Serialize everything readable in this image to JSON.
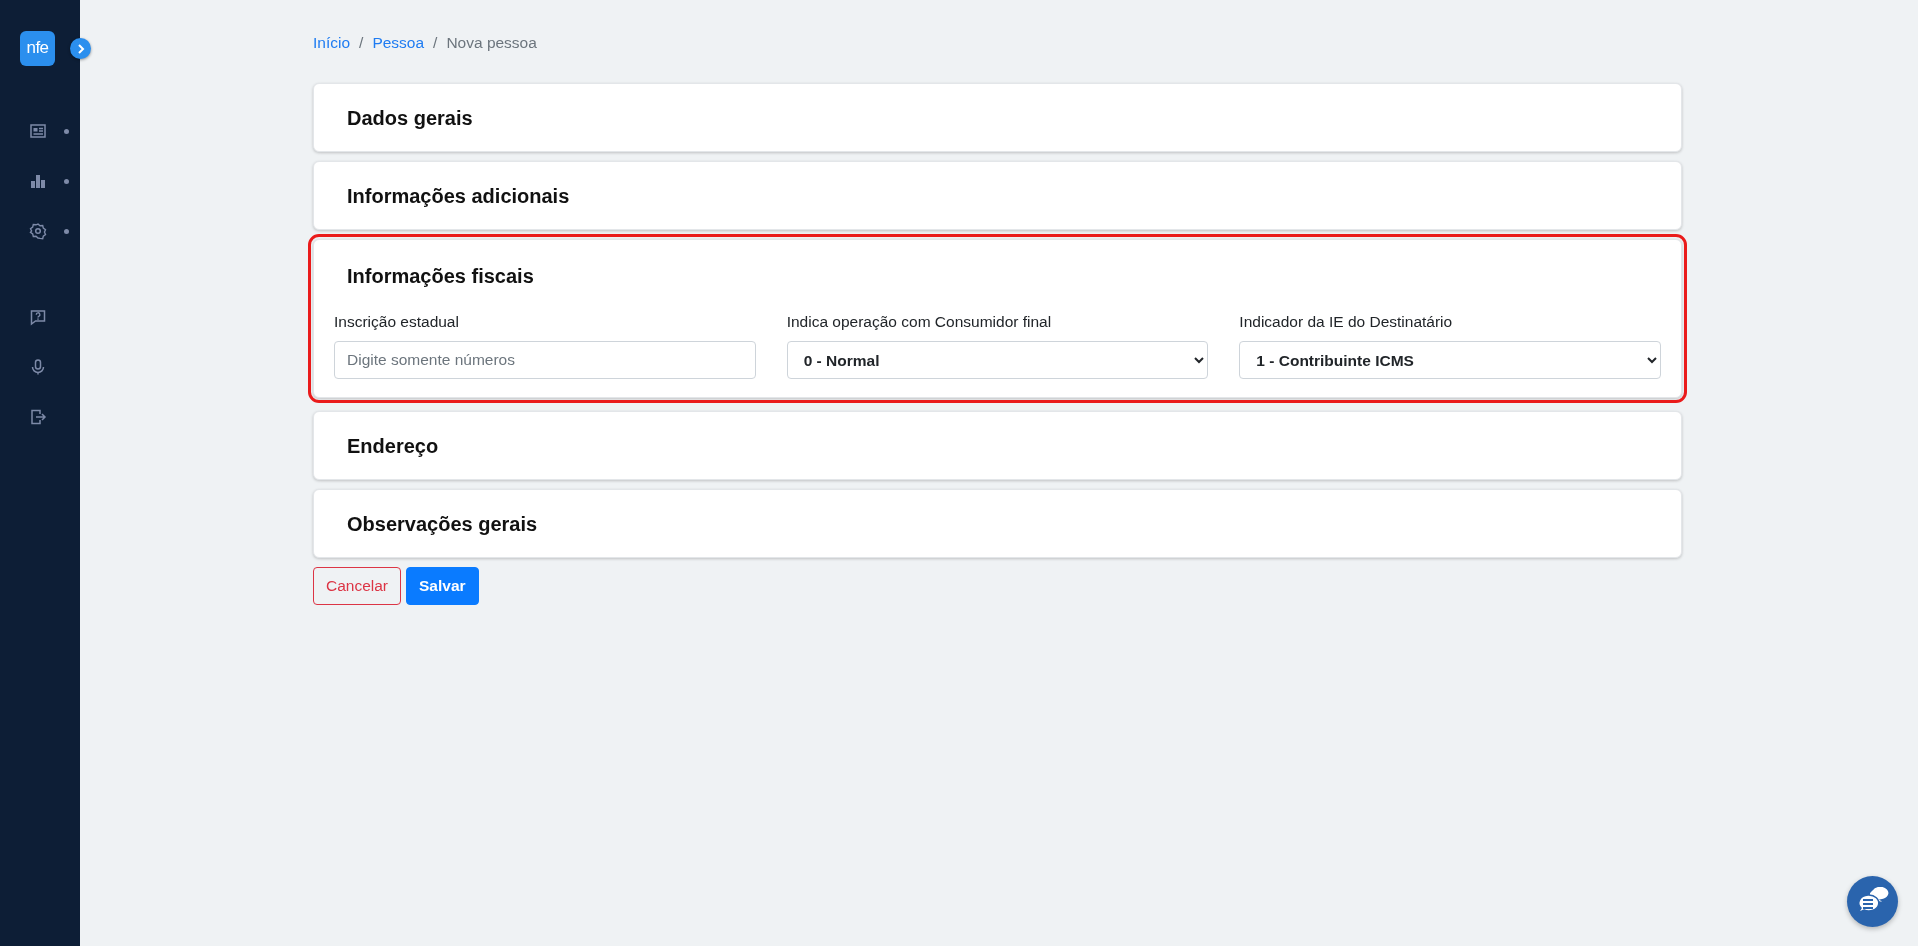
{
  "sidebar": {
    "logo": "nfe",
    "nav_items": [
      {
        "kind": "newspaper",
        "has_submenu": true
      },
      {
        "kind": "chart",
        "has_submenu": true
      },
      {
        "kind": "gear",
        "has_submenu": true
      }
    ],
    "bottom_items": [
      {
        "kind": "help"
      },
      {
        "kind": "microphone"
      },
      {
        "kind": "logout"
      }
    ]
  },
  "breadcrumb": [
    {
      "kind": "link",
      "label": "Início"
    },
    {
      "kind": "separator",
      "label": "/"
    },
    {
      "kind": "link",
      "label": "Pessoa"
    },
    {
      "kind": "separator",
      "label": "/"
    },
    {
      "kind": "current",
      "label": "Nova pessoa"
    }
  ],
  "sections": [
    {
      "title": "Dados gerais",
      "expanded": false,
      "highlighted": false
    },
    {
      "title": "Informações adicionais",
      "expanded": false,
      "highlighted": false
    },
    {
      "title": "Informações fiscais",
      "expanded": true,
      "highlighted": true,
      "fields": [
        {
          "kind": "text",
          "label": "Inscrição estadual",
          "placeholder": "Digite somente números"
        },
        {
          "kind": "select",
          "label": "Indica operação com Consumidor final",
          "value": "0 - Normal"
        },
        {
          "kind": "select",
          "label": "Indicador da IE do Destinatário",
          "value": "1 - Contribuinte ICMS"
        }
      ]
    },
    {
      "title": "Endereço",
      "expanded": false,
      "highlighted": false
    },
    {
      "title": "Observações gerais",
      "expanded": false,
      "highlighted": false
    }
  ],
  "buttons": [
    {
      "label": "Cancelar",
      "kind": "outline-danger"
    },
    {
      "label": "Salvar",
      "kind": "primary"
    }
  ]
}
